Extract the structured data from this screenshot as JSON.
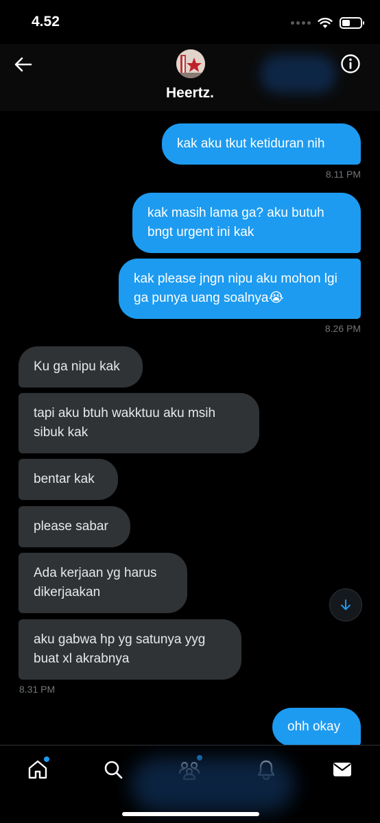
{
  "status": {
    "time": "4.52"
  },
  "header": {
    "name": "Heertz."
  },
  "messages": [
    {
      "text": "kak aku tkut ketiduran nih"
    },
    {
      "text": "kak masih lama ga? aku butuh bngt urgent ini kak"
    },
    {
      "text": "kak please jngn nipu aku mohon lgi ga punya uang soalnya😭"
    },
    {
      "text": "Ku ga nipu kak"
    },
    {
      "text": "tapi aku btuh wakktuu aku msih sibuk kak"
    },
    {
      "text": "bentar kak"
    },
    {
      "text": "please sabar"
    },
    {
      "text": "Ada kerjaan yg harus dikerjaakan"
    },
    {
      "text": "aku gabwa hp yg satunya yyg buat xl akrabnya"
    },
    {
      "text": "ohh okay"
    }
  ],
  "times": [
    "8.11 PM",
    "8.26 PM",
    "8.31 PM"
  ],
  "tabs": [
    "home-icon",
    "search-icon",
    "communities-icon",
    "notifications-icon",
    "messages-icon"
  ],
  "colors": {
    "accent": "#1d9bf0",
    "received_bubble": "#2f3336",
    "background": "#000000"
  }
}
